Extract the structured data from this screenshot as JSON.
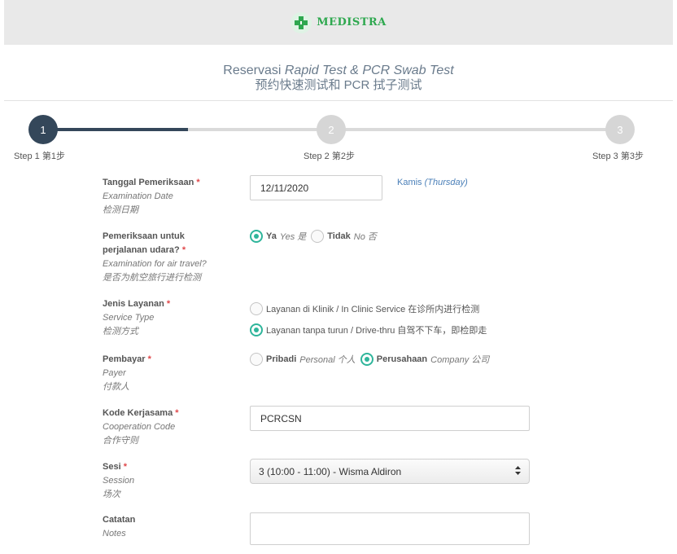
{
  "brand": {
    "name": "MEDISTRA",
    "icon": "green-cross-icon",
    "color": "#2ea84f"
  },
  "page_title": {
    "prefix": "Reservasi ",
    "italic": "Rapid Test & PCR Swab Test",
    "subtitle": "预约快速测试和 PCR 拭子测试"
  },
  "stepper": {
    "active_color": "#34475a",
    "inactive_color": "#d6d6d6",
    "progress": 0.25,
    "steps": [
      {
        "number": "1",
        "label": "Step 1 第1步",
        "active": true
      },
      {
        "number": "2",
        "label": "Step 2 第2步",
        "active": false
      },
      {
        "number": "3",
        "label": "Step 3 第3步",
        "active": false
      }
    ]
  },
  "form": {
    "exam_date": {
      "label": "Tanggal Pemeriksaan",
      "label_en": "Examination Date",
      "label_zh": "检测日期",
      "value": "12/11/2020",
      "day_note": "Kamis",
      "day_note_en": "(Thursday)"
    },
    "air_travel": {
      "label1": "Pemeriksaan untuk",
      "label2": "perjalanan udara?",
      "label_en": "Examination for air travel?",
      "label_zh": "是否为航空旅行进行检测",
      "options": [
        {
          "bold": "Ya",
          "rest": "Yes 是",
          "selected": true
        },
        {
          "bold": "Tidak",
          "rest": "No 否",
          "selected": false
        }
      ]
    },
    "service_type": {
      "label": "Jenis Layanan",
      "label_en": "Service Type",
      "label_zh": "检测方式",
      "options": [
        {
          "text": "Layanan di Klinik / In Clinic Service 在诊所内进行检测",
          "selected": false
        },
        {
          "text": "Layanan tanpa turun / Drive-thru 自驾不下车，即检即走",
          "selected": true
        }
      ]
    },
    "payer": {
      "label": "Pembayar",
      "label_en": "Payer",
      "label_zh": "付款人",
      "options": [
        {
          "bold": "Pribadi",
          "rest": "Personal 个人",
          "selected": false
        },
        {
          "bold": "Perusahaan",
          "rest": "Company 公司",
          "selected": true
        }
      ]
    },
    "coop_code": {
      "label": "Kode Kerjasama",
      "label_en": "Cooperation Code",
      "label_zh": "合作守则",
      "value": "PCRCSN"
    },
    "session": {
      "label": "Sesi",
      "label_en": "Session",
      "label_zh": "场次",
      "value": "3 (10:00 - 11:00) - Wisma Aldiron"
    },
    "notes": {
      "label": "Catatan",
      "label_en": "Notes",
      "value": ""
    },
    "required_mark": "*"
  }
}
